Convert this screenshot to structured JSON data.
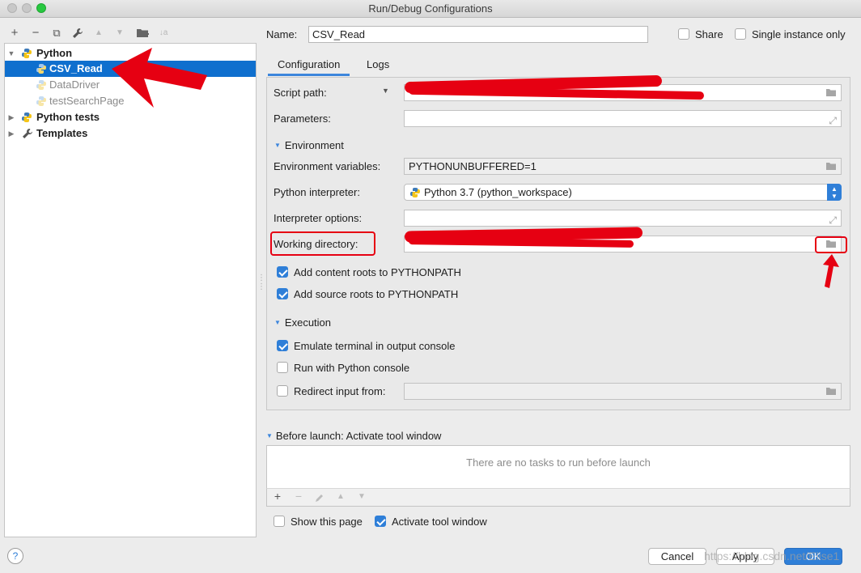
{
  "window": {
    "title": "Run/Debug Configurations"
  },
  "toolbar": {
    "add": "+",
    "remove": "−",
    "copy": "⧉",
    "edit": "🔧",
    "up": "▲",
    "down": "▼",
    "folder": "▣",
    "sort": "↓a"
  },
  "tree": {
    "python": "Python",
    "csv_read": "CSV_Read",
    "datadriver": "DataDriver",
    "testsearchpage": "testSearchPage",
    "python_tests": "Python tests",
    "templates": "Templates"
  },
  "header": {
    "name_label": "Name:",
    "name_value": "CSV_Read",
    "share_label": "Share",
    "single_instance_label": "Single instance only"
  },
  "tabs": {
    "configuration": "Configuration",
    "logs": "Logs"
  },
  "config": {
    "script_path_label": "Script path:",
    "parameters_label": "Parameters:",
    "environment_section": "Environment",
    "env_vars_label": "Environment variables:",
    "env_vars_value": "PYTHONUNBUFFERED=1",
    "interpreter_label": "Python interpreter:",
    "interpreter_value": "Python 3.7 (python_workspace)",
    "interp_options_label": "Interpreter options:",
    "working_dir_label": "Working directory:",
    "add_content_roots": "Add content roots to PYTHONPATH",
    "add_source_roots": "Add source roots to PYTHONPATH",
    "execution_section": "Execution",
    "emulate_terminal": "Emulate terminal in output console",
    "run_with_console": "Run with Python console",
    "redirect_input": "Redirect input from:"
  },
  "before_launch": {
    "title": "Before launch: Activate tool window",
    "empty": "There are no tasks to run before launch",
    "show_page": "Show this page",
    "activate_tool": "Activate tool window"
  },
  "buttons": {
    "help": "?",
    "cancel": "Cancel",
    "apply": "Apply",
    "ok": "OK"
  },
  "watermark": "https://blog.csdn.net/Elise1",
  "colors": {
    "accent": "#2f7fd8",
    "selection": "#0f6fce",
    "annotation": "#e60012"
  }
}
